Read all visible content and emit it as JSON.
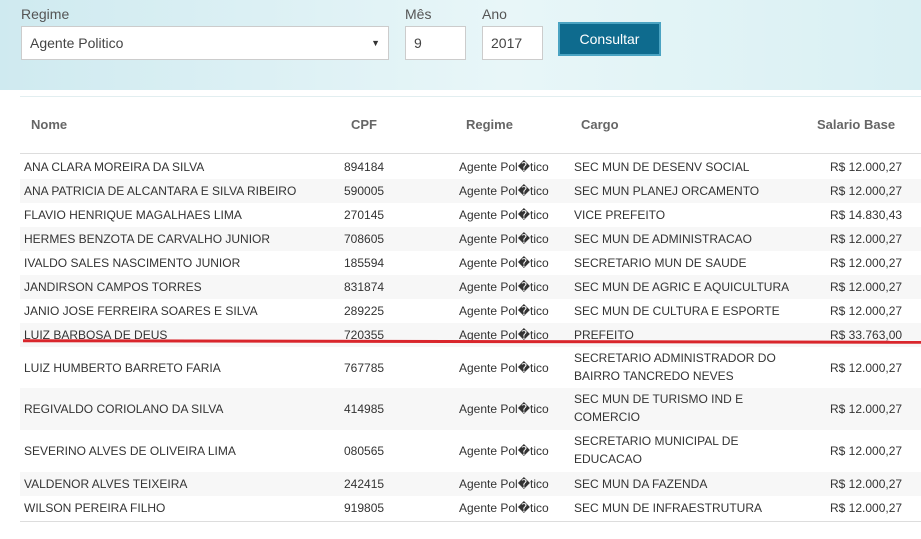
{
  "filters": {
    "regime_label": "Regime",
    "regime_value": "Agente Politico",
    "mes_label": "Mês",
    "mes_value": "9",
    "ano_label": "Ano",
    "ano_value": "2017",
    "submit_label": "Consultar"
  },
  "table": {
    "headers": {
      "nome": "Nome",
      "cpf": "CPF",
      "regime": "Regime",
      "cargo": "Cargo",
      "salario": "Salario Base"
    },
    "rows": [
      {
        "nome": "ANA CLARA MOREIRA DA SILVA",
        "cpf": "894184",
        "regime": "Agente Pol�tico",
        "cargo1": "SEC MUN DE DESENV SOCIAL",
        "cargo2": "",
        "salario": "R$ 12.000,27"
      },
      {
        "nome": "ANA PATRICIA DE ALCANTARA E SILVA RIBEIRO",
        "cpf": "590005",
        "regime": "Agente Pol�tico",
        "cargo1": "SEC MUN PLANEJ ORCAMENTO",
        "cargo2": "",
        "salario": "R$ 12.000,27"
      },
      {
        "nome": "FLAVIO HENRIQUE MAGALHAES LIMA",
        "cpf": "270145",
        "regime": "Agente Pol�tico",
        "cargo1": "VICE PREFEITO",
        "cargo2": "",
        "salario": "R$ 14.830,43"
      },
      {
        "nome": "HERMES BENZOTA DE CARVALHO JUNIOR",
        "cpf": "708605",
        "regime": "Agente Pol�tico",
        "cargo1": "SEC MUN DE ADMINISTRACAO",
        "cargo2": "",
        "salario": "R$ 12.000,27"
      },
      {
        "nome": "IVALDO SALES NASCIMENTO JUNIOR",
        "cpf": "185594",
        "regime": "Agente Pol�tico",
        "cargo1": "SECRETARIO MUN DE SAUDE",
        "cargo2": "",
        "salario": "R$ 12.000,27"
      },
      {
        "nome": "JANDIRSON CAMPOS TORRES",
        "cpf": "831874",
        "regime": "Agente Pol�tico",
        "cargo1": "SEC MUN DE AGRIC E AQUICULTURA",
        "cargo2": "",
        "salario": "R$ 12.000,27"
      },
      {
        "nome": "JANIO JOSE FERREIRA SOARES E SILVA",
        "cpf": "289225",
        "regime": "Agente Pol�tico",
        "cargo1": "SEC MUN DE CULTURA E ESPORTE",
        "cargo2": "",
        "salario": "R$ 12.000,27"
      },
      {
        "nome": "LUIZ BARBOSA DE DEUS",
        "cpf": "720355",
        "regime": "Agente Pol�tico",
        "cargo1": "PREFEITO",
        "cargo2": "",
        "salario": "R$ 33.763,00"
      },
      {
        "nome": "LUIZ HUMBERTO BARRETO FARIA",
        "cpf": "767785",
        "regime": "Agente Pol�tico",
        "cargo1": "SECRETARIO ADMINISTRADOR DO",
        "cargo2": "BAIRRO TANCREDO NEVES",
        "salario": "R$ 12.000,27"
      },
      {
        "nome": "REGIVALDO CORIOLANO DA SILVA",
        "cpf": "414985",
        "regime": "Agente Pol�tico",
        "cargo1": "SEC MUN DE TURISMO IND E",
        "cargo2": "COMERCIO",
        "salario": "R$ 12.000,27"
      },
      {
        "nome": "SEVERINO ALVES DE OLIVEIRA LIMA",
        "cpf": "080565",
        "regime": "Agente Pol�tico",
        "cargo1": "SECRETARIO MUNICIPAL DE",
        "cargo2": "EDUCACAO",
        "salario": "R$ 12.000,27"
      },
      {
        "nome": "VALDENOR ALVES TEIXEIRA",
        "cpf": "242415",
        "regime": "Agente Pol�tico",
        "cargo1": "SEC MUN DA FAZENDA",
        "cargo2": "",
        "salario": "R$ 12.000,27"
      },
      {
        "nome": "WILSON PEREIRA FILHO",
        "cpf": "919805",
        "regime": "Agente Pol�tico",
        "cargo1": "SEC MUN DE INFRAESTRUTURA",
        "cargo2": "",
        "salario": "R$ 12.000,27"
      }
    ]
  },
  "colors": {
    "button_bg": "#0e6b8e",
    "highlight_line": "#d9262c"
  }
}
